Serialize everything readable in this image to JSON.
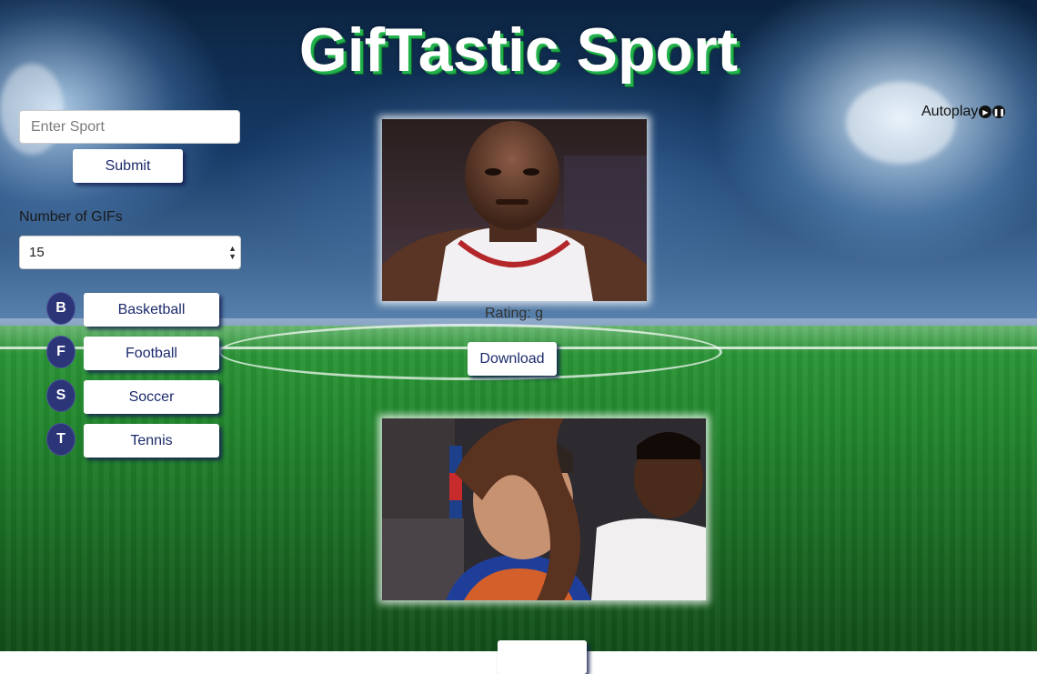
{
  "header": {
    "title": "GifTastic Sport"
  },
  "search": {
    "placeholder": "Enter Sport",
    "submit_label": "Submit"
  },
  "count": {
    "label": "Number of GIFs",
    "selected": "15"
  },
  "sports": [
    {
      "initial": "B",
      "label": "Basketball"
    },
    {
      "initial": "F",
      "label": "Football"
    },
    {
      "initial": "S",
      "label": "Soccer"
    },
    {
      "initial": "T",
      "label": "Tennis"
    }
  ],
  "autoplay": {
    "label": "Autoplay",
    "icons": [
      "play-icon",
      "pause-icon"
    ]
  },
  "results": [
    {
      "rating_text": "Rating: g",
      "download_label": "Download"
    },
    {
      "rating_text": "",
      "download_label": ""
    }
  ],
  "colors": {
    "accent_button_text": "#1b2a6b",
    "circle_badge": "#2c3577",
    "title_shadow": "#22b14c"
  }
}
